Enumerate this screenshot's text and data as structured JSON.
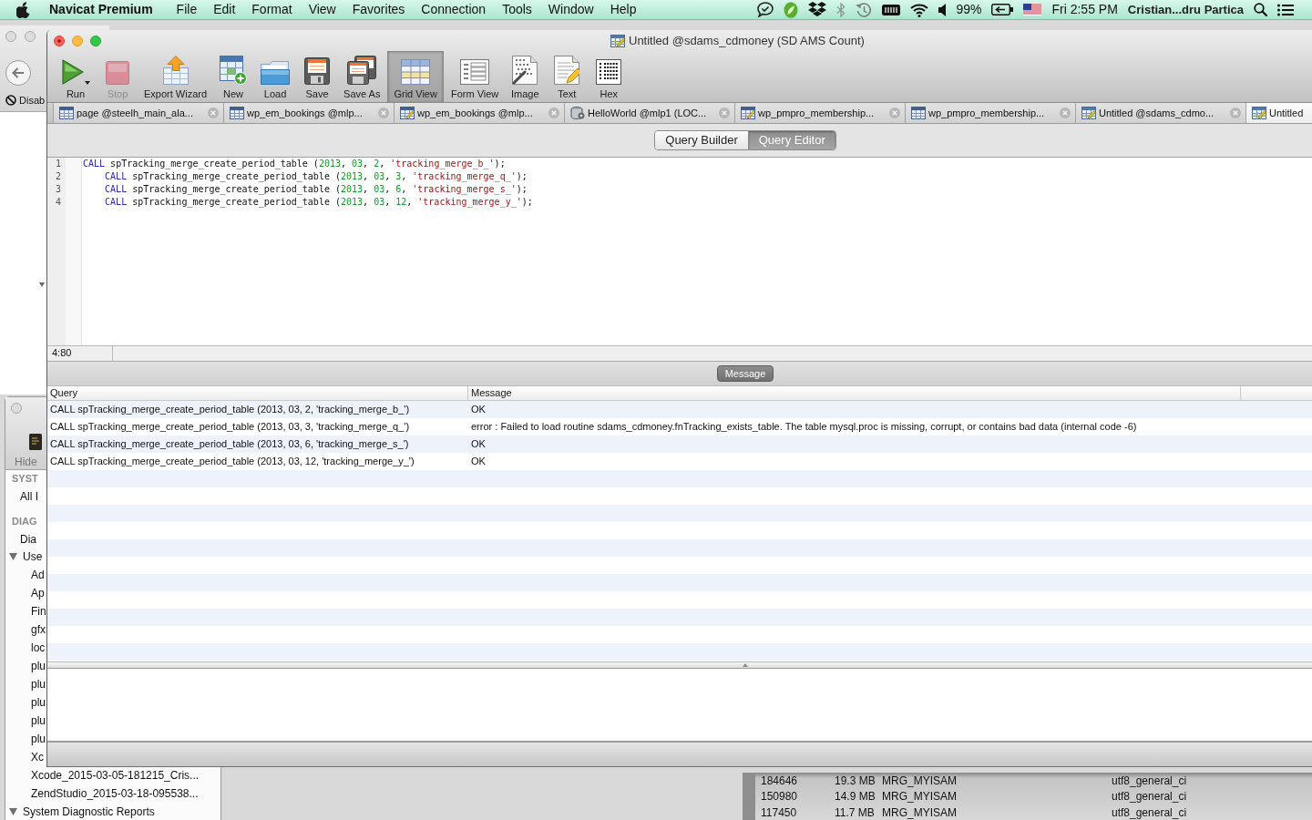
{
  "menu_bar": {
    "app_name": "Navicat Premium",
    "menus": [
      "File",
      "Edit",
      "Format",
      "View",
      "Favorites",
      "Connection",
      "Tools",
      "Window",
      "Help"
    ],
    "battery": "99%",
    "clock": "Fri 2:55 PM",
    "user": "Cristian...dru Partica"
  },
  "browser_window": {
    "toolbar_button": "Disab"
  },
  "window": {
    "title": "Untitled @sdams_cdmoney (SD AMS Count)"
  },
  "toolbar": [
    {
      "label": "Run",
      "kind": "run",
      "dropdown": true,
      "disabled": false,
      "selected": false
    },
    {
      "label": "Stop",
      "kind": "stop",
      "dropdown": false,
      "disabled": true,
      "selected": false
    },
    {
      "label": "Export Wizard",
      "kind": "export",
      "dropdown": false,
      "disabled": false,
      "selected": false
    },
    {
      "label": "New",
      "kind": "new",
      "dropdown": false,
      "disabled": false,
      "selected": false
    },
    {
      "label": "Load",
      "kind": "load",
      "dropdown": false,
      "disabled": false,
      "selected": false
    },
    {
      "label": "Save",
      "kind": "save",
      "dropdown": false,
      "disabled": false,
      "selected": false
    },
    {
      "label": "Save As",
      "kind": "save_as",
      "dropdown": false,
      "disabled": false,
      "selected": false
    },
    {
      "label": "Grid View",
      "kind": "grid",
      "dropdown": false,
      "disabled": false,
      "selected": true
    },
    {
      "label": "Form View",
      "kind": "form",
      "dropdown": false,
      "disabled": false,
      "selected": false
    },
    {
      "label": "Image",
      "kind": "image",
      "dropdown": false,
      "disabled": false,
      "selected": false
    },
    {
      "label": "Text",
      "kind": "text",
      "dropdown": false,
      "disabled": false,
      "selected": false
    },
    {
      "label": "Hex",
      "kind": "hex",
      "dropdown": false,
      "disabled": false,
      "selected": false
    }
  ],
  "tabs": [
    {
      "label": "page @steelh_main_ala...",
      "kind": "table",
      "selected": false,
      "closable": true
    },
    {
      "label": "wp_em_bookings @mlp...",
      "kind": "table",
      "selected": false,
      "closable": true
    },
    {
      "label": "wp_em_bookings @mlp...",
      "kind": "design",
      "selected": false,
      "closable": true
    },
    {
      "label": "HelloWorld @mlp1 (LOC...",
      "kind": "function",
      "selected": false,
      "closable": true
    },
    {
      "label": "wp_pmpro_membership...",
      "kind": "design",
      "selected": false,
      "closable": true
    },
    {
      "label": "wp_pmpro_membership...",
      "kind": "table",
      "selected": false,
      "closable": true
    },
    {
      "label": "Untitled @sdams_cdmo...",
      "kind": "query",
      "selected": false,
      "closable": true
    },
    {
      "label": "Untitled",
      "kind": "query",
      "selected": true,
      "closable": false
    }
  ],
  "mode_switch": [
    {
      "label": "Query Builder",
      "selected": false
    },
    {
      "label": "Query Editor",
      "selected": true
    }
  ],
  "editor": {
    "lines": [
      {
        "number": "1",
        "code": "CALL spTracking_merge_create_period_table (2013, 03, 2, 'tracking_merge_b_');"
      },
      {
        "number": "2",
        "code": "    CALL spTracking_merge_create_period_table (2013, 03, 3, 'tracking_merge_q_');"
      },
      {
        "number": "3",
        "code": "    CALL spTracking_merge_create_period_table (2013, 03, 6, 'tracking_merge_s_');"
      },
      {
        "number": "4",
        "code": "    CALL spTracking_merge_create_period_table (2013, 03, 12, 'tracking_merge_y_');"
      }
    ],
    "cursor": "4:80"
  },
  "results": {
    "tabs": [
      {
        "label": "Message",
        "selected": true
      }
    ],
    "columns": [
      "Query",
      "Message"
    ],
    "rows": [
      {
        "query": "CALL spTracking_merge_create_period_table (2013, 03, 2, 'tracking_merge_b_')",
        "message": "OK"
      },
      {
        "query": "CALL spTracking_merge_create_period_table (2013, 03, 3, 'tracking_merge_q_')",
        "message": "error : Failed to load routine sdams_cdmoney.fnTracking_exists_table. The table mysql.proc is missing, corrupt, or contains bad data (internal code -6)"
      },
      {
        "query": "CALL spTracking_merge_create_period_table (2013, 03, 6, 'tracking_merge_s_')",
        "message": "OK"
      },
      {
        "query": "CALL spTracking_merge_create_period_table (2013, 03, 12, 'tracking_merge_y_')",
        "message": "OK"
      }
    ]
  },
  "console_window": {
    "toolbar_label": "Hide",
    "sidebar": [
      {
        "kind": "heading",
        "label": "SYST"
      },
      {
        "kind": "item",
        "label": "All I"
      },
      {
        "kind": "heading",
        "label": "DIAG"
      },
      {
        "kind": "item",
        "label": "Dia"
      },
      {
        "kind": "group",
        "label": "Use",
        "expanded": true,
        "children": [
          {
            "label": "Ad"
          },
          {
            "label": "Ap"
          },
          {
            "label": "Fin"
          },
          {
            "label": "gfx"
          },
          {
            "label": "loc"
          },
          {
            "label": "plu"
          },
          {
            "label": "plu"
          },
          {
            "label": "plu"
          },
          {
            "label": "plu"
          },
          {
            "label": "plu"
          },
          {
            "label": "Xc"
          },
          {
            "label": "Xcode_2015-03-05-181215_Cris..."
          },
          {
            "label": "ZendStudio_2015-03-18-095538..."
          }
        ]
      },
      {
        "kind": "group",
        "label": "System Diagnostic Reports",
        "expanded": true
      }
    ]
  },
  "table_window": {
    "rows": [
      [
        "184646",
        "19.3 MB",
        "MRG_MYISAM",
        "utf8_general_ci"
      ],
      [
        "150980",
        "14.9 MB",
        "MRG_MYISAM",
        "utf8_general_ci"
      ],
      [
        "117450",
        "11.7 MB",
        "MRG_MYISAM",
        "utf8_general_ci"
      ]
    ]
  }
}
